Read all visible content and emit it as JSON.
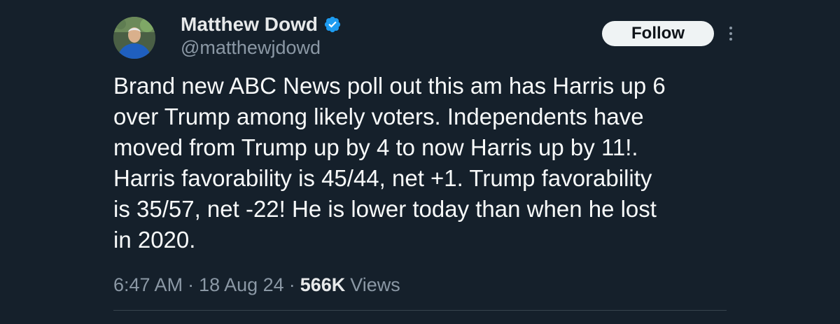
{
  "author": {
    "display_name": "Matthew Dowd",
    "handle": "@matthewjdowd",
    "verified": true
  },
  "actions": {
    "follow_label": "Follow",
    "more_icon": "more-vertical-icon"
  },
  "tweet": {
    "lines": [
      "Brand new ABC News poll out this am has Harris up 6",
      "over Trump among likely voters.  Independents have",
      "moved from Trump up by 4 to now Harris up by 11!.",
      "Harris favorability is 45/44, net +1.  Trump favorability",
      "is 35/57, net -22!  He is lower today than when he lost",
      "in 2020."
    ]
  },
  "meta": {
    "time": "6:47 AM",
    "date": "18 Aug 24",
    "separator": "·",
    "views_count": "566K",
    "views_label": "Views"
  },
  "colors": {
    "background": "#15202b",
    "text_primary": "#f7f9f9",
    "text_secondary": "#8b98a5",
    "verified_blue": "#1d9bf0",
    "follow_bg": "#eff3f4"
  }
}
